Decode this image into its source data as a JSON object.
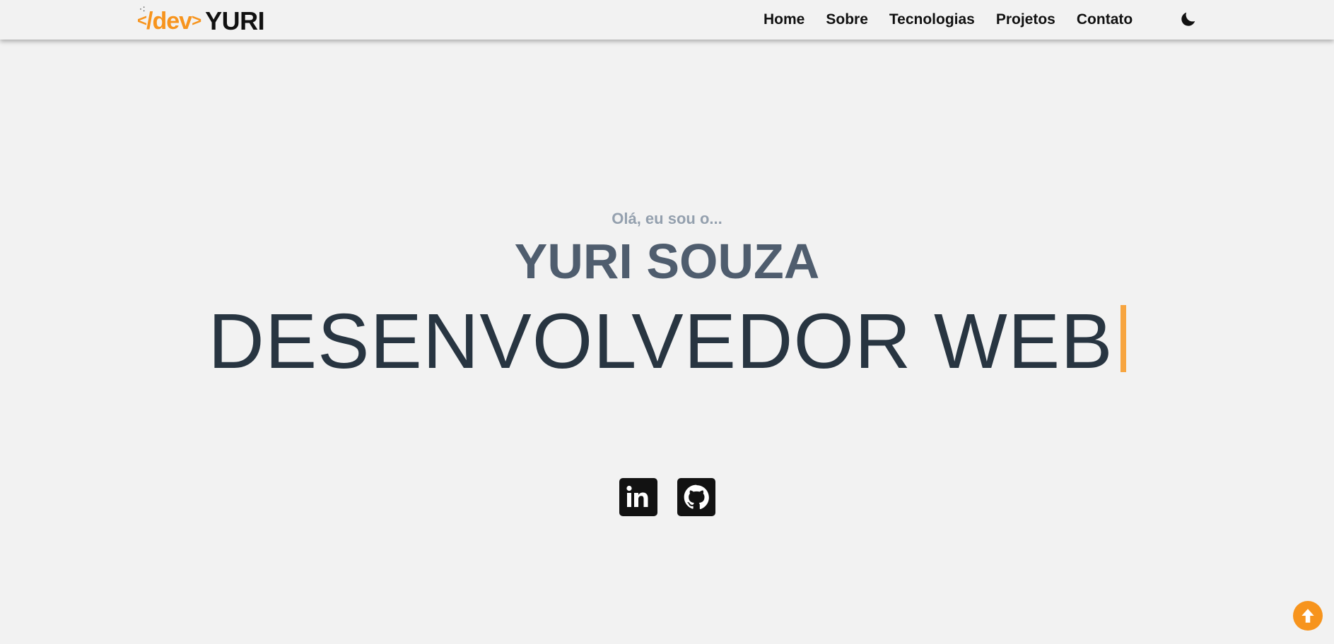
{
  "brand": {
    "code": "/dev",
    "open_angle": "<",
    "close_angle": ">",
    "name": "YURI",
    "dots": "·:"
  },
  "nav": {
    "items": [
      {
        "label": "Home"
      },
      {
        "label": "Sobre"
      },
      {
        "label": "Tecnologias"
      },
      {
        "label": "Projetos"
      },
      {
        "label": "Contato"
      }
    ],
    "theme_icon": "moon-icon"
  },
  "hero": {
    "greeting": "Olá, eu sou o...",
    "name": "YURI SOUZA",
    "role": "DESENVOLVEDOR WEB"
  },
  "socials": [
    {
      "icon": "linkedin-icon"
    },
    {
      "icon": "github-icon"
    }
  ],
  "back_to_top_icon": "arrow-up-icon",
  "colors": {
    "accent": "#f7941d",
    "background": "#f2f2f2",
    "name_text": "#4f5d6e",
    "role_text": "#283541",
    "greeting_text": "#94a0ae",
    "cursor": "#f7a540"
  }
}
